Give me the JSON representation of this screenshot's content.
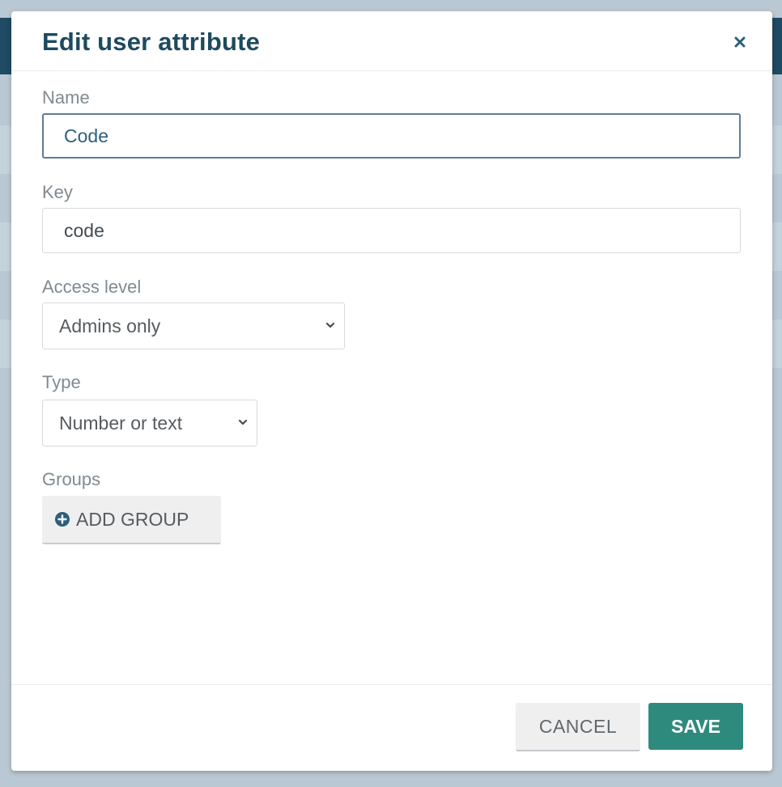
{
  "dialog": {
    "title": "Edit user attribute",
    "close_icon": "close-icon"
  },
  "fields": {
    "name": {
      "label": "Name",
      "value": "Code"
    },
    "key": {
      "label": "Key",
      "value": "code"
    },
    "access_level": {
      "label": "Access level",
      "selected": "Admins only"
    },
    "type": {
      "label": "Type",
      "selected": "Number or text"
    },
    "groups": {
      "label": "Groups",
      "add_button_label": "ADD GROUP",
      "add_icon": "plus-circle-icon"
    }
  },
  "footer": {
    "cancel_label": "CANCEL",
    "save_label": "SAVE"
  },
  "colors": {
    "title": "#1d4a5e",
    "primary": "#2f8a7e",
    "focus_border": "#5f7d90",
    "overlay": "#b9c8d3"
  }
}
